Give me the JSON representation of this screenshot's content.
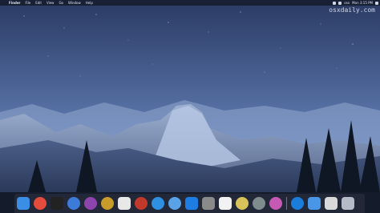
{
  "menubar": {
    "apple_icon": "apple-logo",
    "app_name": "Finder",
    "items": [
      "File",
      "Edit",
      "View",
      "Go",
      "Window",
      "Help"
    ],
    "status": {
      "user": "osx",
      "clock": "Mon 3:15 PM"
    }
  },
  "desktop": {
    "watermark": "osxdaily.com"
  },
  "dock": {
    "apps": [
      {
        "icon": "finder-icon",
        "color": "#3a8ee6"
      },
      {
        "icon": "chrome-icon",
        "color": "#e34c3c"
      },
      {
        "icon": "terminal-icon",
        "color": "#222222"
      },
      {
        "icon": "safari-icon",
        "color": "#3d7bd9"
      },
      {
        "icon": "itunes-icon",
        "color": "#8e44ad"
      },
      {
        "icon": "coins-icon",
        "color": "#c89b2a"
      },
      {
        "icon": "calendar-icon",
        "color": "#e8e8e8"
      },
      {
        "icon": "pocket-icon",
        "color": "#c0392b"
      },
      {
        "icon": "twitter-icon",
        "color": "#2f8fe0"
      },
      {
        "icon": "tweetbot-icon",
        "color": "#5aa2e8"
      },
      {
        "icon": "app-store-icon",
        "color": "#1e7de3"
      },
      {
        "icon": "preview-icon",
        "color": "#8a8a8a"
      },
      {
        "icon": "notes-icon",
        "color": "#f2f2f2"
      },
      {
        "icon": "photos-icon",
        "color": "#d8c35a"
      },
      {
        "icon": "settings-icon",
        "color": "#7f8c8d"
      },
      {
        "icon": "music-icon",
        "color": "#c45ab3"
      }
    ],
    "right": [
      {
        "icon": "app-store-blue-icon",
        "color": "#1a7ddb"
      },
      {
        "icon": "folder-icon",
        "color": "#4a96e6"
      },
      {
        "icon": "documents-icon",
        "color": "#d9d9d9"
      },
      {
        "icon": "trash-icon",
        "color": "#b6bcc7"
      }
    ]
  }
}
